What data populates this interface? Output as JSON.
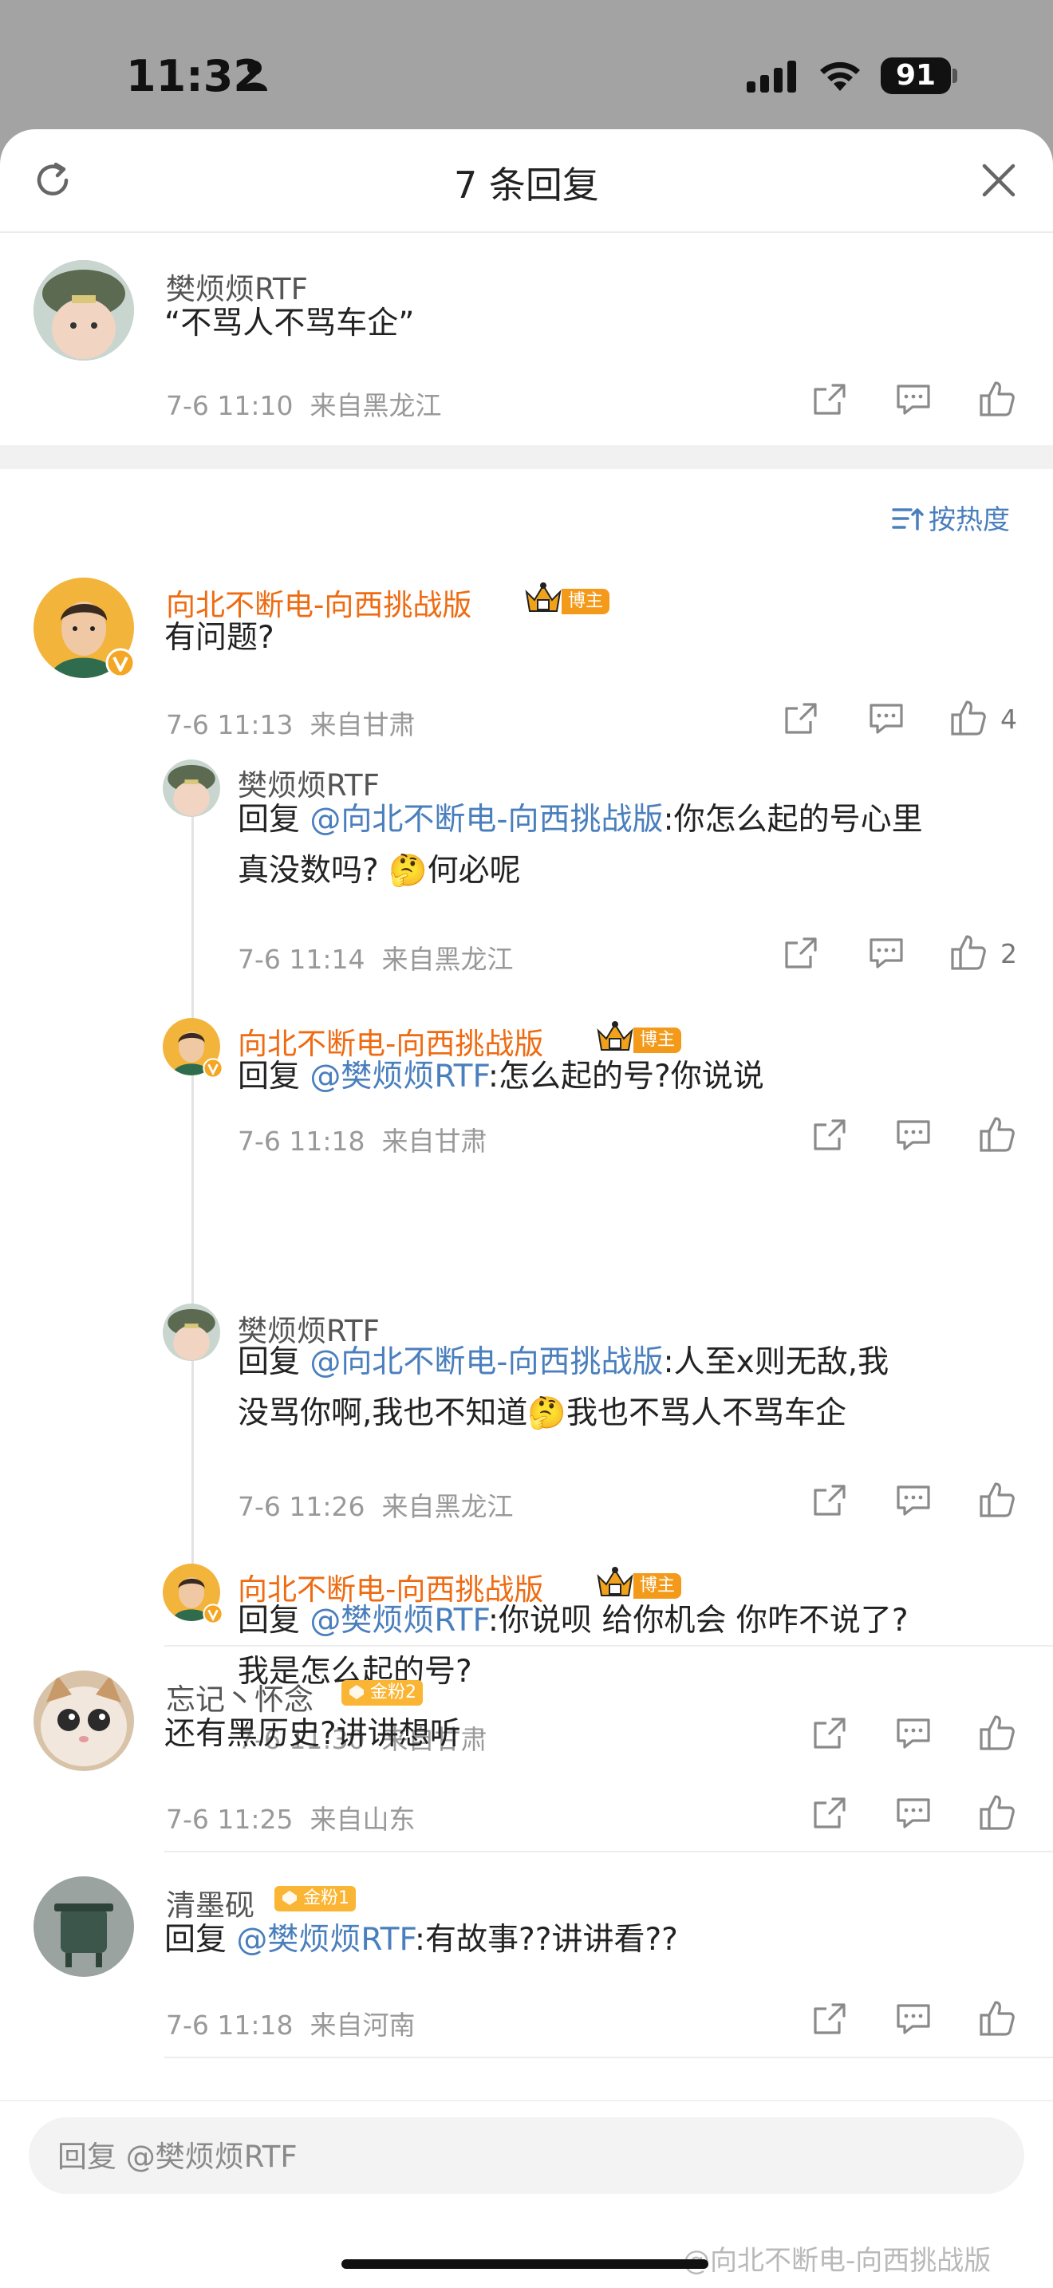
{
  "status_bar": {
    "time": "11:32",
    "battery": "91"
  },
  "header": {
    "title": "7 条回复"
  },
  "root_comment": {
    "username": "樊烦烦RTF",
    "text": "“不骂人不骂车企”",
    "time": "7-6 11:10",
    "location": "来自黑龙江"
  },
  "sort": {
    "label": "按热度"
  },
  "thread": {
    "username": "向北不断电-向西挑战版",
    "badge": "博主",
    "text": "有问题?",
    "time": "7-6 11:13",
    "location": "来自甘肃",
    "likes": "4",
    "replies": [
      {
        "username": "樊烦烦RTF",
        "prefix": "回复 ",
        "mention": "@向北不断电-向西挑战版",
        "line1": ":你怎么起的号心里",
        "line2": "真没数吗?",
        "line2_after": "何必呢",
        "emoji": "🤔",
        "time": "7-6 11:14",
        "location": "来自黑龙江",
        "likes": "2"
      },
      {
        "username": "向北不断电-向西挑战版",
        "badge": "博主",
        "prefix": "回复 ",
        "mention": "@樊烦烦RTF",
        "line1": ":怎么起的号?你说说",
        "time": "7-6 11:18",
        "location": "来自甘肃"
      },
      {
        "username": "樊烦烦RTF",
        "prefix": "回复 ",
        "mention": "@向北不断电-向西挑战版",
        "line1": ":人至x则无敌,我",
        "line2": "没骂你啊,我也不知道",
        "line2_after": "我也不骂人不骂车企",
        "emoji": "🤔",
        "time": "7-6 11:26",
        "location": "来自黑龙江"
      },
      {
        "username": "向北不断电-向西挑战版",
        "badge": "博主",
        "prefix": "回复 ",
        "mention": "@樊烦烦RTF",
        "line1": ":你说呗 给你机会 你咋不说了?",
        "line2": "我是怎么起的号?",
        "time": "7-6 11:30",
        "location": "来自甘肃"
      }
    ]
  },
  "comments": [
    {
      "username": "忘记丶怀念",
      "badge": "金粉2",
      "text": "还有黑历史?讲讲想听",
      "time": "7-6 11:25",
      "location": "来自山东"
    },
    {
      "username": "清墨砚",
      "badge": "金粉1",
      "prefix": "回复 ",
      "mention": "@樊烦烦RTF",
      "text": ":有故事??讲讲看??",
      "time": "7-6 11:18",
      "location": "来自河南"
    }
  ],
  "reply_input": {
    "placeholder": "回复 @樊烦烦RTF"
  },
  "watermark": "@向北不断电-向西挑战版"
}
